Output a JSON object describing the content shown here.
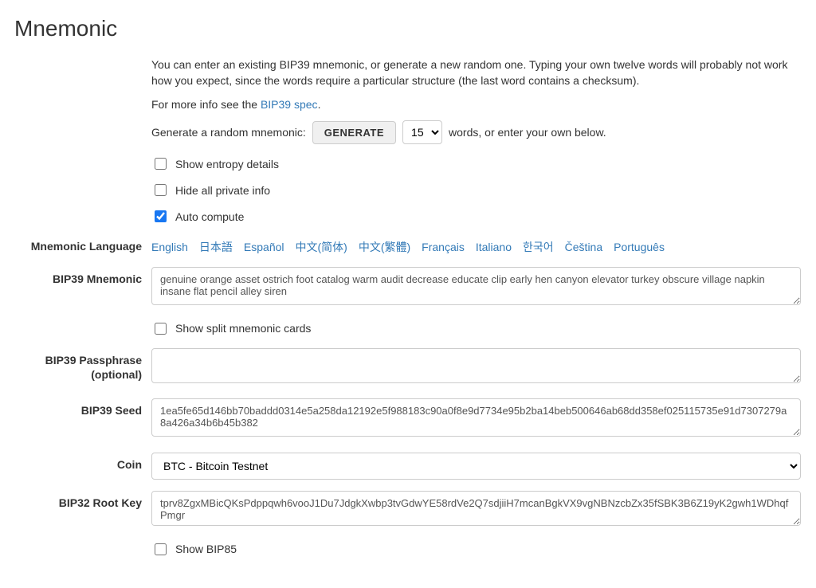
{
  "title": "Mnemonic",
  "intro": {
    "p1": "You can enter an existing BIP39 mnemonic, or generate a new random one. Typing your own twelve words will probably not work how you expect, since the words require a particular structure (the last word contains a checksum).",
    "more_prefix": "For more info see the ",
    "spec_link": "BIP39 spec",
    "gen_prefix": "Generate a random mnemonic: ",
    "gen_btn": "GENERATE",
    "words_count": "15",
    "gen_suffix": " words, or enter your own below."
  },
  "checks": {
    "entropy": "Show entropy details",
    "hidepriv": "Hide all private info",
    "autocompute": "Auto compute",
    "splitcards": "Show split mnemonic cards",
    "bip85": "Show BIP85"
  },
  "labels": {
    "lang": "Mnemonic Language",
    "mnemonic": "BIP39 Mnemonic",
    "passphrase1": "BIP39 Passphrase",
    "passphrase2": "(optional)",
    "seed": "BIP39 Seed",
    "coin": "Coin",
    "rootkey": "BIP32 Root Key"
  },
  "languages": [
    "English",
    "日本語",
    "Español",
    "中文(简体)",
    "中文(繁體)",
    "Français",
    "Italiano",
    "한국어",
    "Čeština",
    "Português"
  ],
  "values": {
    "mnemonic": "genuine orange asset ostrich foot catalog warm audit decrease educate clip early hen canyon elevator turkey obscure village napkin insane flat pencil alley siren",
    "passphrase": "",
    "seed": "1ea5fe65d146bb70baddd0314e5a258da12192e5f988183c90a0f8e9d7734e95b2ba14beb500646ab68dd358ef025115735e91d7307279a8a426a34b6b45b382",
    "coin": "BTC - Bitcoin Testnet",
    "rootkey": "tprv8ZgxMBicQKsPdppqwh6vooJ1Du7JdgkXwbp3tvGdwYE58rdVe2Q7sdjiiH7mcanBgkVX9vgNBNzcbZx35fSBK3B6Z19yK2gwh1WDhqfPmgr"
  }
}
